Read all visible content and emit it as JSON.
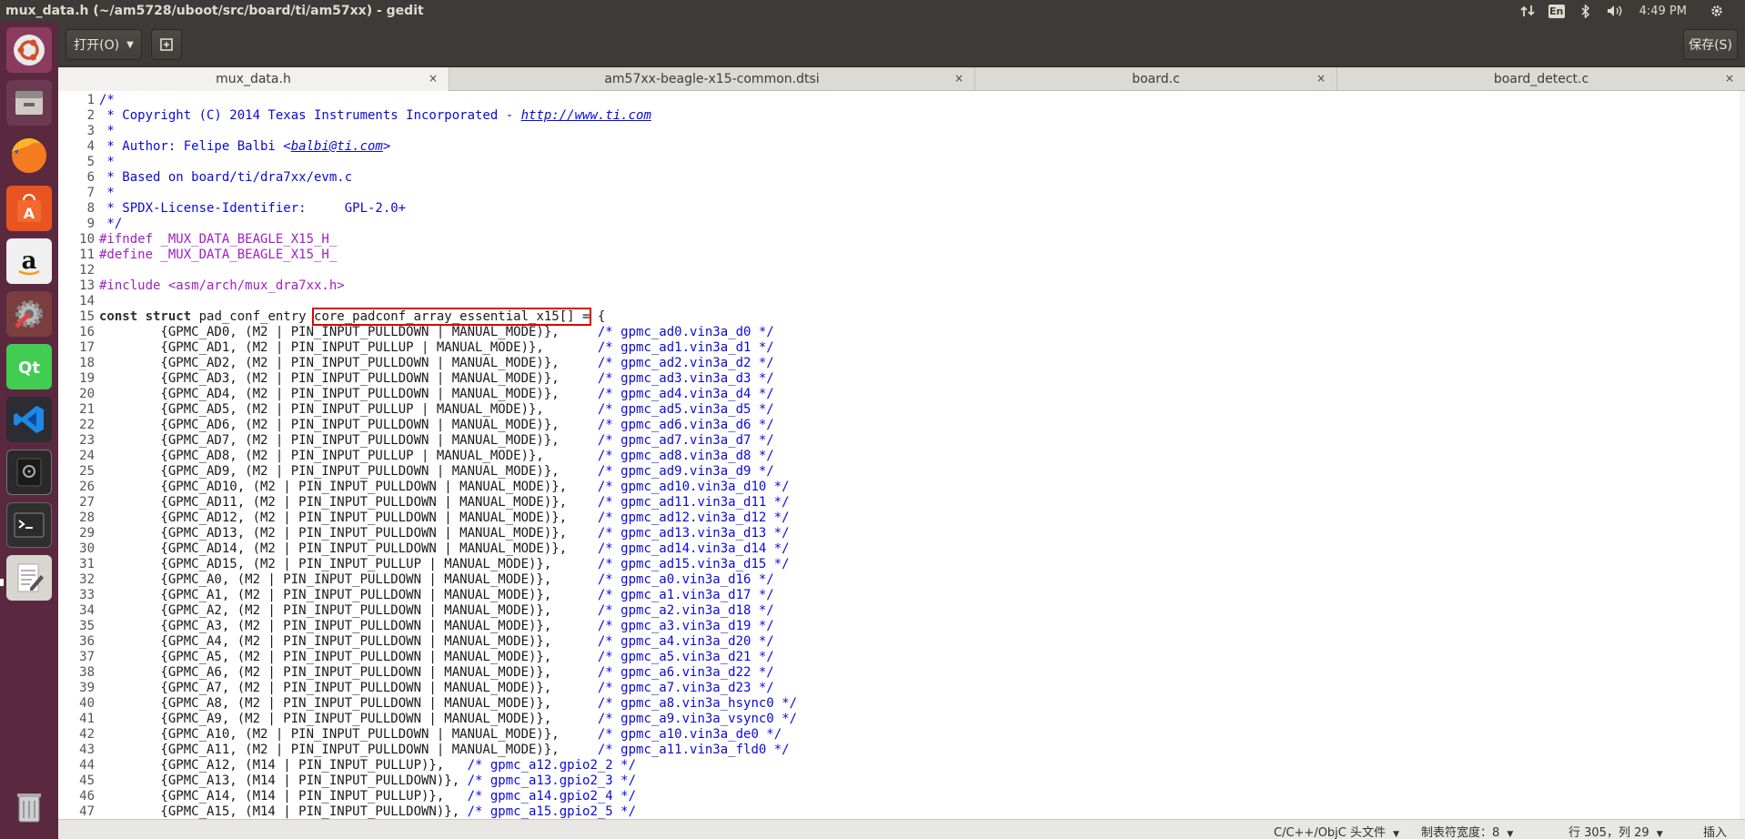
{
  "window_title": "mux_data.h (~/am5728/uboot/src/board/ti/am57xx) - gedit",
  "tray": {
    "lang": "En",
    "time": "4:49 PM"
  },
  "toolbar": {
    "open_label": "打开(O)",
    "save_label": "保存(S)"
  },
  "tabs": [
    {
      "label": "mux_data.h",
      "active": true
    },
    {
      "label": "am57xx-beagle-x15-common.dtsi",
      "active": false
    },
    {
      "label": "board.c",
      "active": false
    },
    {
      "label": "board_detect.c",
      "active": false
    }
  ],
  "tab_close_glyph": "×",
  "code_lines": [
    {
      "n": "1",
      "parts": [
        {
          "t": "/*",
          "c": "c-cm"
        }
      ]
    },
    {
      "n": "2",
      "parts": [
        {
          "t": " * Copyright (C) 2014 Texas Instruments Incorporated - ",
          "c": "c-cm"
        },
        {
          "t": "http://www.ti.com",
          "c": "c-link"
        }
      ]
    },
    {
      "n": "3",
      "parts": [
        {
          "t": " *",
          "c": "c-cm"
        }
      ]
    },
    {
      "n": "4",
      "parts": [
        {
          "t": " * Author: Felipe Balbi <",
          "c": "c-cm"
        },
        {
          "t": "balbi@ti.com",
          "c": "c-link"
        },
        {
          "t": ">",
          "c": "c-cm"
        }
      ]
    },
    {
      "n": "5",
      "parts": [
        {
          "t": " *",
          "c": "c-cm"
        }
      ]
    },
    {
      "n": "6",
      "parts": [
        {
          "t": " * Based on board/ti/dra7xx/evm.c",
          "c": "c-cm"
        }
      ]
    },
    {
      "n": "7",
      "parts": [
        {
          "t": " *",
          "c": "c-cm"
        }
      ]
    },
    {
      "n": "8",
      "parts": [
        {
          "t": " * SPDX-License-Identifier:     GPL-2.0+",
          "c": "c-cm"
        }
      ]
    },
    {
      "n": "9",
      "parts": [
        {
          "t": " */",
          "c": "c-cm"
        }
      ]
    },
    {
      "n": "10",
      "parts": [
        {
          "t": "#ifndef _MUX_DATA_BEAGLE_X15_H_",
          "c": "c-pp"
        }
      ]
    },
    {
      "n": "11",
      "parts": [
        {
          "t": "#define _MUX_DATA_BEAGLE_X15_H_",
          "c": "c-pp"
        }
      ]
    },
    {
      "n": "12",
      "parts": []
    },
    {
      "n": "13",
      "parts": [
        {
          "t": "#include <asm/arch/mux_dra7xx.h>",
          "c": "c-pp"
        }
      ]
    },
    {
      "n": "14",
      "parts": []
    },
    {
      "n": "15",
      "parts": [
        {
          "t": "const struct",
          "c": "c-kw"
        },
        {
          "t": " pad_conf_entry ",
          "c": ""
        },
        {
          "t": "core_padconf_array_essential_x15[] =",
          "c": "hl-box"
        },
        {
          "t": " {",
          "c": ""
        }
      ]
    },
    {
      "n": "16",
      "parts": [
        {
          "t": "        {GPMC_AD0, (M2 | PIN_INPUT_PULLDOWN | MANUAL_MODE)},     ",
          "c": ""
        },
        {
          "t": "/* gpmc_ad0.vin3a_d0 */",
          "c": "c-cm"
        }
      ]
    },
    {
      "n": "17",
      "parts": [
        {
          "t": "        {GPMC_AD1, (M2 | PIN_INPUT_PULLUP | MANUAL_MODE)},       ",
          "c": ""
        },
        {
          "t": "/* gpmc_ad1.vin3a_d1 */",
          "c": "c-cm"
        }
      ]
    },
    {
      "n": "18",
      "parts": [
        {
          "t": "        {GPMC_AD2, (M2 | PIN_INPUT_PULLDOWN | MANUAL_MODE)},     ",
          "c": ""
        },
        {
          "t": "/* gpmc_ad2.vin3a_d2 */",
          "c": "c-cm"
        }
      ]
    },
    {
      "n": "19",
      "parts": [
        {
          "t": "        {GPMC_AD3, (M2 | PIN_INPUT_PULLDOWN | MANUAL_MODE)},     ",
          "c": ""
        },
        {
          "t": "/* gpmc_ad3.vin3a_d3 */",
          "c": "c-cm"
        }
      ]
    },
    {
      "n": "20",
      "parts": [
        {
          "t": "        {GPMC_AD4, (M2 | PIN_INPUT_PULLDOWN | MANUAL_MODE)},     ",
          "c": ""
        },
        {
          "t": "/* gpmc_ad4.vin3a_d4 */",
          "c": "c-cm"
        }
      ]
    },
    {
      "n": "21",
      "parts": [
        {
          "t": "        {GPMC_AD5, (M2 | PIN_INPUT_PULLUP | MANUAL_MODE)},       ",
          "c": ""
        },
        {
          "t": "/* gpmc_ad5.vin3a_d5 */",
          "c": "c-cm"
        }
      ]
    },
    {
      "n": "22",
      "parts": [
        {
          "t": "        {GPMC_AD6, (M2 | PIN_INPUT_PULLDOWN | MANUAL_MODE)},     ",
          "c": ""
        },
        {
          "t": "/* gpmc_ad6.vin3a_d6 */",
          "c": "c-cm"
        }
      ]
    },
    {
      "n": "23",
      "parts": [
        {
          "t": "        {GPMC_AD7, (M2 | PIN_INPUT_PULLDOWN | MANUAL_MODE)},     ",
          "c": ""
        },
        {
          "t": "/* gpmc_ad7.vin3a_d7 */",
          "c": "c-cm"
        }
      ]
    },
    {
      "n": "24",
      "parts": [
        {
          "t": "        {GPMC_AD8, (M2 | PIN_INPUT_PULLUP | MANUAL_MODE)},       ",
          "c": ""
        },
        {
          "t": "/* gpmc_ad8.vin3a_d8 */",
          "c": "c-cm"
        }
      ]
    },
    {
      "n": "25",
      "parts": [
        {
          "t": "        {GPMC_AD9, (M2 | PIN_INPUT_PULLDOWN | MANUAL_MODE)},     ",
          "c": ""
        },
        {
          "t": "/* gpmc_ad9.vin3a_d9 */",
          "c": "c-cm"
        }
      ]
    },
    {
      "n": "26",
      "parts": [
        {
          "t": "        {GPMC_AD10, (M2 | PIN_INPUT_PULLDOWN | MANUAL_MODE)},    ",
          "c": ""
        },
        {
          "t": "/* gpmc_ad10.vin3a_d10 */",
          "c": "c-cm"
        }
      ]
    },
    {
      "n": "27",
      "parts": [
        {
          "t": "        {GPMC_AD11, (M2 | PIN_INPUT_PULLDOWN | MANUAL_MODE)},    ",
          "c": ""
        },
        {
          "t": "/* gpmc_ad11.vin3a_d11 */",
          "c": "c-cm"
        }
      ]
    },
    {
      "n": "28",
      "parts": [
        {
          "t": "        {GPMC_AD12, (M2 | PIN_INPUT_PULLDOWN | MANUAL_MODE)},    ",
          "c": ""
        },
        {
          "t": "/* gpmc_ad12.vin3a_d12 */",
          "c": "c-cm"
        }
      ]
    },
    {
      "n": "29",
      "parts": [
        {
          "t": "        {GPMC_AD13, (M2 | PIN_INPUT_PULLDOWN | MANUAL_MODE)},    ",
          "c": ""
        },
        {
          "t": "/* gpmc_ad13.vin3a_d13 */",
          "c": "c-cm"
        }
      ]
    },
    {
      "n": "30",
      "parts": [
        {
          "t": "        {GPMC_AD14, (M2 | PIN_INPUT_PULLDOWN | MANUAL_MODE)},    ",
          "c": ""
        },
        {
          "t": "/* gpmc_ad14.vin3a_d14 */",
          "c": "c-cm"
        }
      ]
    },
    {
      "n": "31",
      "parts": [
        {
          "t": "        {GPMC_AD15, (M2 | PIN_INPUT_PULLUP | MANUAL_MODE)},      ",
          "c": ""
        },
        {
          "t": "/* gpmc_ad15.vin3a_d15 */",
          "c": "c-cm"
        }
      ]
    },
    {
      "n": "32",
      "parts": [
        {
          "t": "        {GPMC_A0, (M2 | PIN_INPUT_PULLDOWN | MANUAL_MODE)},      ",
          "c": ""
        },
        {
          "t": "/* gpmc_a0.vin3a_d16 */",
          "c": "c-cm"
        }
      ]
    },
    {
      "n": "33",
      "parts": [
        {
          "t": "        {GPMC_A1, (M2 | PIN_INPUT_PULLDOWN | MANUAL_MODE)},      ",
          "c": ""
        },
        {
          "t": "/* gpmc_a1.vin3a_d17 */",
          "c": "c-cm"
        }
      ]
    },
    {
      "n": "34",
      "parts": [
        {
          "t": "        {GPMC_A2, (M2 | PIN_INPUT_PULLDOWN | MANUAL_MODE)},      ",
          "c": ""
        },
        {
          "t": "/* gpmc_a2.vin3a_d18 */",
          "c": "c-cm"
        }
      ]
    },
    {
      "n": "35",
      "parts": [
        {
          "t": "        {GPMC_A3, (M2 | PIN_INPUT_PULLDOWN | MANUAL_MODE)},      ",
          "c": ""
        },
        {
          "t": "/* gpmc_a3.vin3a_d19 */",
          "c": "c-cm"
        }
      ]
    },
    {
      "n": "36",
      "parts": [
        {
          "t": "        {GPMC_A4, (M2 | PIN_INPUT_PULLDOWN | MANUAL_MODE)},      ",
          "c": ""
        },
        {
          "t": "/* gpmc_a4.vin3a_d20 */",
          "c": "c-cm"
        }
      ]
    },
    {
      "n": "37",
      "parts": [
        {
          "t": "        {GPMC_A5, (M2 | PIN_INPUT_PULLDOWN | MANUAL_MODE)},      ",
          "c": ""
        },
        {
          "t": "/* gpmc_a5.vin3a_d21 */",
          "c": "c-cm"
        }
      ]
    },
    {
      "n": "38",
      "parts": [
        {
          "t": "        {GPMC_A6, (M2 | PIN_INPUT_PULLDOWN | MANUAL_MODE)},      ",
          "c": ""
        },
        {
          "t": "/* gpmc_a6.vin3a_d22 */",
          "c": "c-cm"
        }
      ]
    },
    {
      "n": "39",
      "parts": [
        {
          "t": "        {GPMC_A7, (M2 | PIN_INPUT_PULLDOWN | MANUAL_MODE)},      ",
          "c": ""
        },
        {
          "t": "/* gpmc_a7.vin3a_d23 */",
          "c": "c-cm"
        }
      ]
    },
    {
      "n": "40",
      "parts": [
        {
          "t": "        {GPMC_A8, (M2 | PIN_INPUT_PULLDOWN | MANUAL_MODE)},      ",
          "c": ""
        },
        {
          "t": "/* gpmc_a8.vin3a_hsync0 */",
          "c": "c-cm"
        }
      ]
    },
    {
      "n": "41",
      "parts": [
        {
          "t": "        {GPMC_A9, (M2 | PIN_INPUT_PULLDOWN | MANUAL_MODE)},      ",
          "c": ""
        },
        {
          "t": "/* gpmc_a9.vin3a_vsync0 */",
          "c": "c-cm"
        }
      ]
    },
    {
      "n": "42",
      "parts": [
        {
          "t": "        {GPMC_A10, (M2 | PIN_INPUT_PULLDOWN | MANUAL_MODE)},     ",
          "c": ""
        },
        {
          "t": "/* gpmc_a10.vin3a_de0 */",
          "c": "c-cm"
        }
      ]
    },
    {
      "n": "43",
      "parts": [
        {
          "t": "        {GPMC_A11, (M2 | PIN_INPUT_PULLDOWN | MANUAL_MODE)},     ",
          "c": ""
        },
        {
          "t": "/* gpmc_a11.vin3a_fld0 */",
          "c": "c-cm"
        }
      ]
    },
    {
      "n": "44",
      "parts": [
        {
          "t": "        {GPMC_A12, (M14 | PIN_INPUT_PULLUP)},   ",
          "c": ""
        },
        {
          "t": "/* gpmc_a12.gpio2_2 */",
          "c": "c-cm"
        }
      ]
    },
    {
      "n": "45",
      "parts": [
        {
          "t": "        {GPMC_A13, (M14 | PIN_INPUT_PULLDOWN)}, ",
          "c": ""
        },
        {
          "t": "/* gpmc_a13.gpio2_3 */",
          "c": "c-cm"
        }
      ]
    },
    {
      "n": "46",
      "parts": [
        {
          "t": "        {GPMC_A14, (M14 | PIN_INPUT_PULLUP)},   ",
          "c": ""
        },
        {
          "t": "/* gpmc_a14.gpio2_4 */",
          "c": "c-cm"
        }
      ]
    },
    {
      "n": "47",
      "parts": [
        {
          "t": "        {GPMC_A15, (M14 | PIN_INPUT_PULLDOWN)}, ",
          "c": ""
        },
        {
          "t": "/* gpmc_a15.gpio2_5 */",
          "c": "c-cm"
        }
      ]
    }
  ],
  "statusbar": {
    "language": "C/C++/ObjC 头文件",
    "tab_width": "制表符宽度：8",
    "position": "行 305，列 29",
    "mode": "插入"
  },
  "launcher_items": [
    "ubuntu-dash-icon",
    "files-icon",
    "firefox-icon",
    "software-center-icon",
    "amazon-icon",
    "system-settings-icon",
    "qt-creator-icon",
    "vscode-icon",
    "disk-icon",
    "terminal-icon",
    "text-editor-icon",
    "trash-icon"
  ]
}
